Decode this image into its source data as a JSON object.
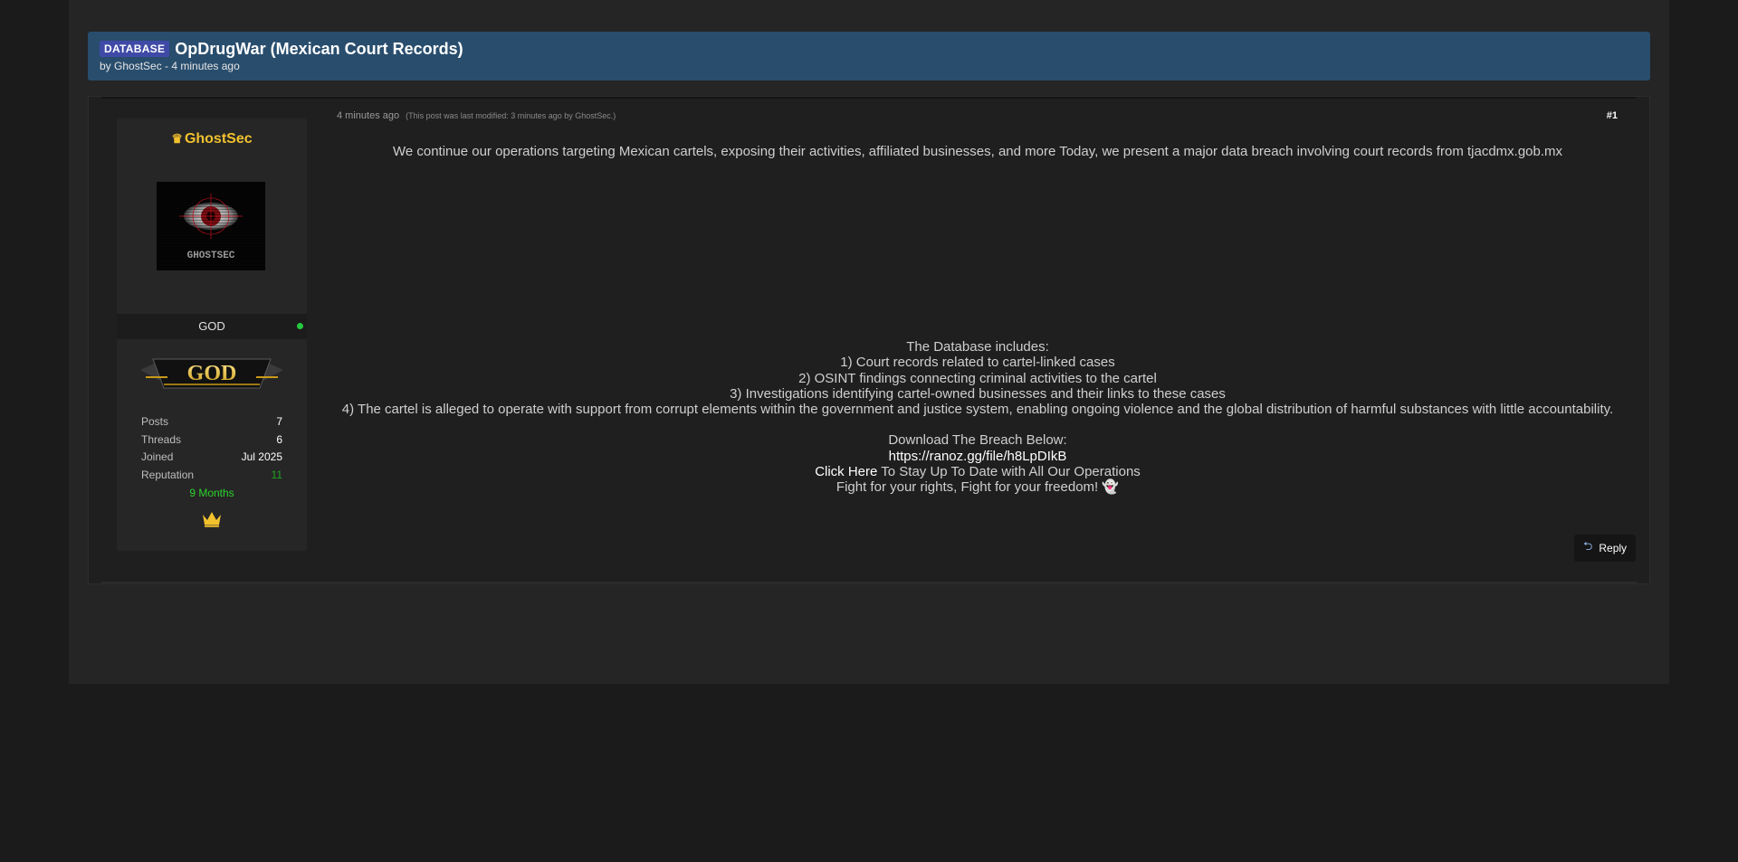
{
  "thread": {
    "prefix": "DATABASE",
    "title": "OpDrugWar (Mexican Court Records)",
    "byline": "by GhostSec - 4 minutes ago"
  },
  "author": {
    "name": "GhostSec",
    "avatar_text": "GHOSTSEC",
    "rank": "GOD",
    "rank_badge_text": "GOD",
    "status_color": "#26c93f",
    "stats": [
      {
        "label": "Posts",
        "value": "7"
      },
      {
        "label": "Threads",
        "value": "6"
      },
      {
        "label": "Joined",
        "value": "Jul 2025"
      },
      {
        "label": "Reputation",
        "value": "11"
      }
    ],
    "membership": "9 Months"
  },
  "post": {
    "time": "4 minutes ago",
    "modified": "(This post was last modified: 3 minutes ago by GhostSec.)",
    "number": "#1",
    "intro": "We continue our operations targeting Mexican cartels, exposing their activities, affiliated businesses, and more Today, we present a major data breach involving court records from tjacdmx.gob.mx",
    "db_heading": "The Database includes:",
    "db_items": [
      "1) Court records related to cartel-linked cases",
      "2) OSINT findings connecting criminal activities to the cartel",
      "3) Investigations identifying cartel-owned businesses and their links to these cases",
      "4) The cartel is alleged to operate with support from corrupt elements within the government and justice system, enabling ongoing violence and the global distribution of harmful substances with little accountability."
    ],
    "download_label": "Download The Breach Below:",
    "download_link": "https://ranoz.gg/file/h8LpDIkB",
    "click_here": "Click Here",
    "stay_updated": " To Stay Up To Date with All Our Operations",
    "closing": "Fight for your rights, Fight for your freedom!",
    "closing_emoji": "👻"
  },
  "actions": {
    "reply_label": "Reply"
  },
  "colors": {
    "header_bg": "#294d6d",
    "prefix_bg": "#3f4aa6",
    "username": "#f2c12e",
    "membership": "#2bd32b",
    "reputation": "#1fa51f"
  }
}
